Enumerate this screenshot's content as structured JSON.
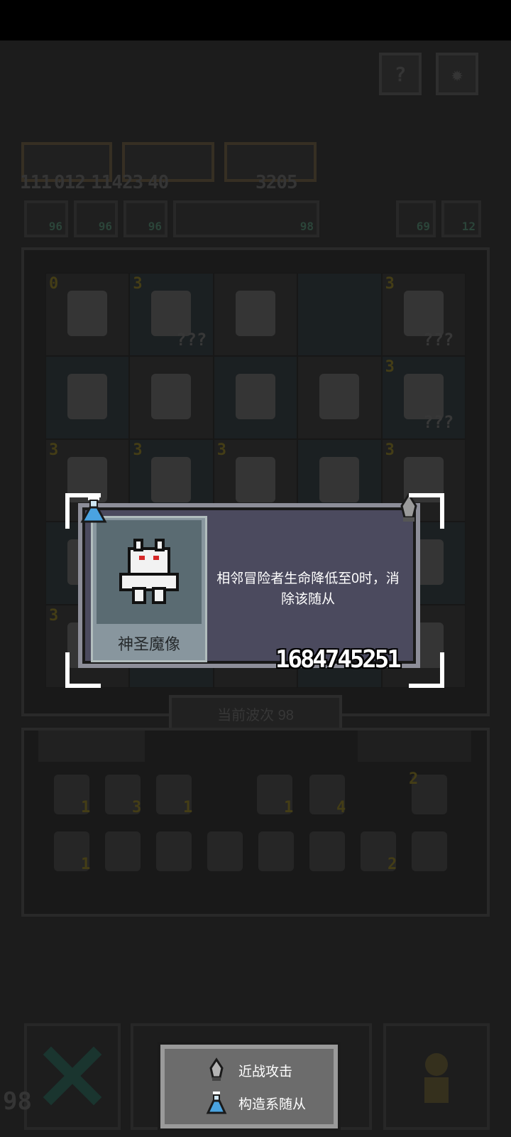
{
  "hud": {
    "resource_counts": [
      "111",
      "012",
      "11423",
      "40",
      "3205"
    ],
    "stats": [
      "96",
      "96",
      "96",
      "98"
    ],
    "side_counts": [
      "69",
      "12"
    ]
  },
  "board": {
    "level_badges": [
      "0",
      "3",
      "3",
      "3",
      "3",
      "3",
      "3",
      "3",
      "3"
    ],
    "unknown_marker": "???"
  },
  "wave": {
    "label": "当前波次 98"
  },
  "inventory": {
    "counts": [
      "1",
      "3",
      "1",
      "1",
      "4",
      "2",
      "1",
      "2"
    ]
  },
  "bottom": {
    "left_count": "98"
  },
  "popup": {
    "name": "神圣魔像",
    "description": "相邻冒险者生命降低至0时，消除该随从",
    "code": "1684745251"
  },
  "legend": {
    "items": [
      {
        "icon": "sword-icon",
        "label": "近战攻击"
      },
      {
        "icon": "flask-icon",
        "label": "构造系随从"
      }
    ]
  },
  "colors": {
    "popup_bg": "#4b4a5e",
    "popup_border": "#8d8e99",
    "flask": "#4aa3e0"
  }
}
